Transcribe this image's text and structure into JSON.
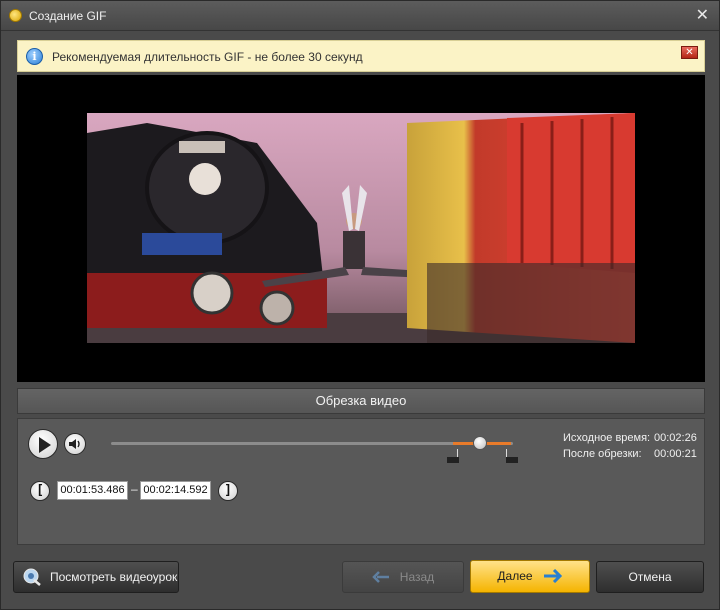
{
  "window": {
    "title": "Создание GIF",
    "close_glyph": "✕"
  },
  "banner": {
    "icon": "info-icon",
    "text": "Рекомендуемая длительность GIF - не более 30 секунд",
    "close_glyph": "✕"
  },
  "section": {
    "title": "Обрезка видео"
  },
  "player": {
    "play_icon": "play-icon",
    "volume_icon": "volume-icon",
    "trim_start_fraction": 0.85,
    "trim_end_fraction": 0.996,
    "playhead_fraction": 0.917
  },
  "info": {
    "source_label": "Исходное время:",
    "source_value": "00:02:26",
    "trimmed_label": "После обрезки:",
    "trimmed_value": "00:00:21"
  },
  "trim": {
    "start_bracket": "[",
    "start_time": "00:01:53.486",
    "separator": "–",
    "end_time": "00:02:14.592",
    "end_bracket": "]"
  },
  "buttons": {
    "help_label": "Посмотреть видеоурок",
    "back_label": "Назад",
    "next_label": "Далее",
    "cancel_label": "Отмена"
  },
  "colors": {
    "accent_orange": "#e97b2a",
    "primary_button": "#f5b400",
    "banner_bg": "#fbf3c6"
  }
}
